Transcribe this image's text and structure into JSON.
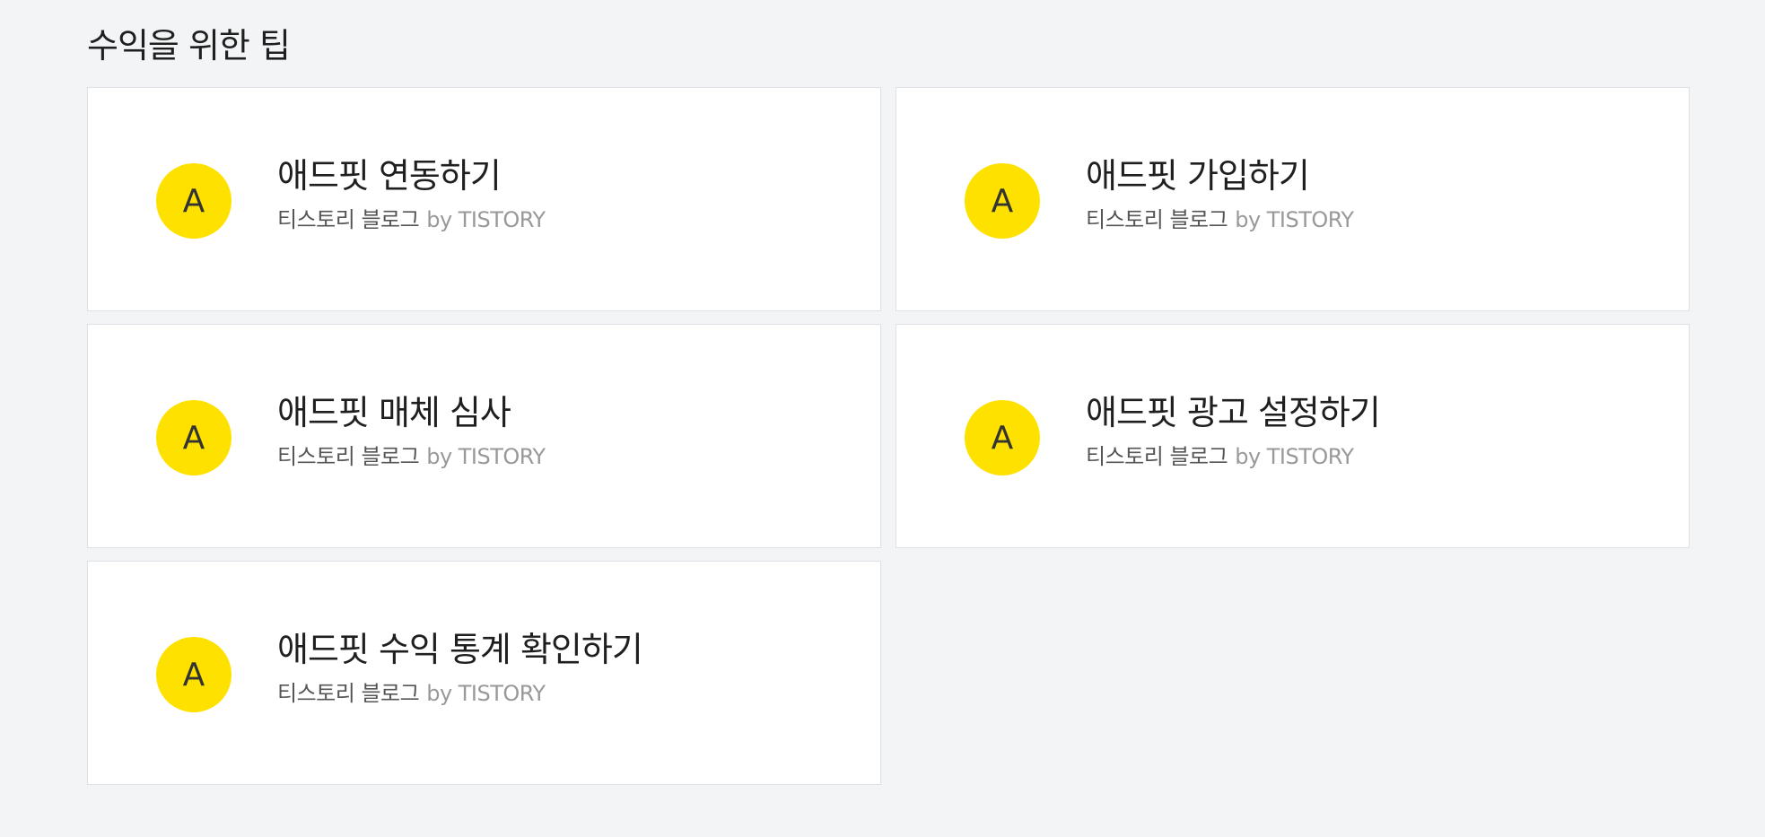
{
  "section": {
    "title": "수익을 위한 팁"
  },
  "cards": [
    {
      "avatar_letter": "A",
      "title": "애드핏 연동하기",
      "blog": "티스토리 블로그",
      "by": "by TISTORY"
    },
    {
      "avatar_letter": "A",
      "title": "애드핏 가입하기",
      "blog": "티스토리 블로그",
      "by": "by TISTORY"
    },
    {
      "avatar_letter": "A",
      "title": "애드핏 매체 심사",
      "blog": "티스토리 블로그",
      "by": "by TISTORY"
    },
    {
      "avatar_letter": "A",
      "title": "애드핏 광고 설정하기",
      "blog": "티스토리 블로그",
      "by": "by TISTORY"
    },
    {
      "avatar_letter": "A",
      "title": "애드핏 수익 통계 확인하기",
      "blog": "티스토리 블로그",
      "by": "by TISTORY"
    }
  ],
  "colors": {
    "background": "#f3f4f6",
    "card": "#ffffff",
    "avatar": "#ffe100",
    "by_text": "#999999"
  }
}
